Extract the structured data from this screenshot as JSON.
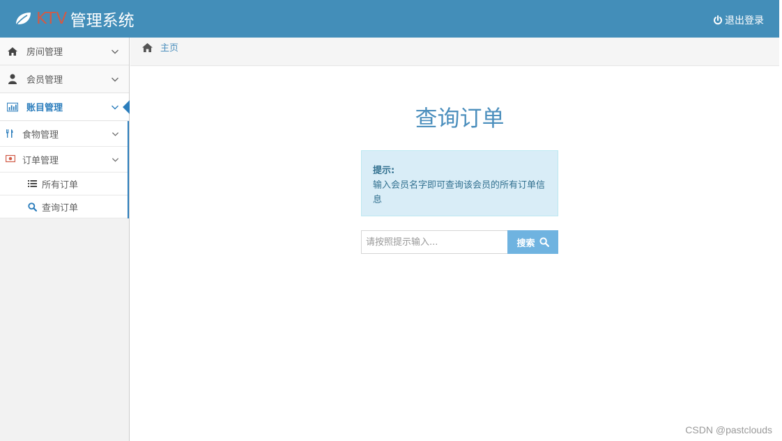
{
  "header": {
    "brand_accent": "KTV",
    "brand_main": "管理系统",
    "logout_label": "退出登录",
    "colors": {
      "bar": "#438eb9",
      "accent": "#d15b47"
    }
  },
  "sidebar": {
    "items": [
      {
        "label": "房间管理",
        "icon": "home-icon"
      },
      {
        "label": "会员管理",
        "icon": "user-icon"
      },
      {
        "label": "账目管理",
        "icon": "bar-chart-icon",
        "active": true
      }
    ],
    "submenu": [
      {
        "label": "食物管理",
        "icon": "cutlery-icon"
      },
      {
        "label": "订单管理",
        "icon": "money-icon"
      }
    ],
    "leaves": [
      {
        "label": "所有订单",
        "icon": "list-icon"
      },
      {
        "label": "查询订单",
        "icon": "search-icon"
      }
    ]
  },
  "breadcrumb": {
    "home": "主页"
  },
  "main": {
    "title": "查询订单",
    "tip_title": "提示:",
    "tip_text": "输入会员名字即可查询该会员的所有订单信息",
    "search_placeholder": "请按照提示输入...",
    "search_button": "搜索"
  },
  "watermark": "CSDN @pastclouds"
}
